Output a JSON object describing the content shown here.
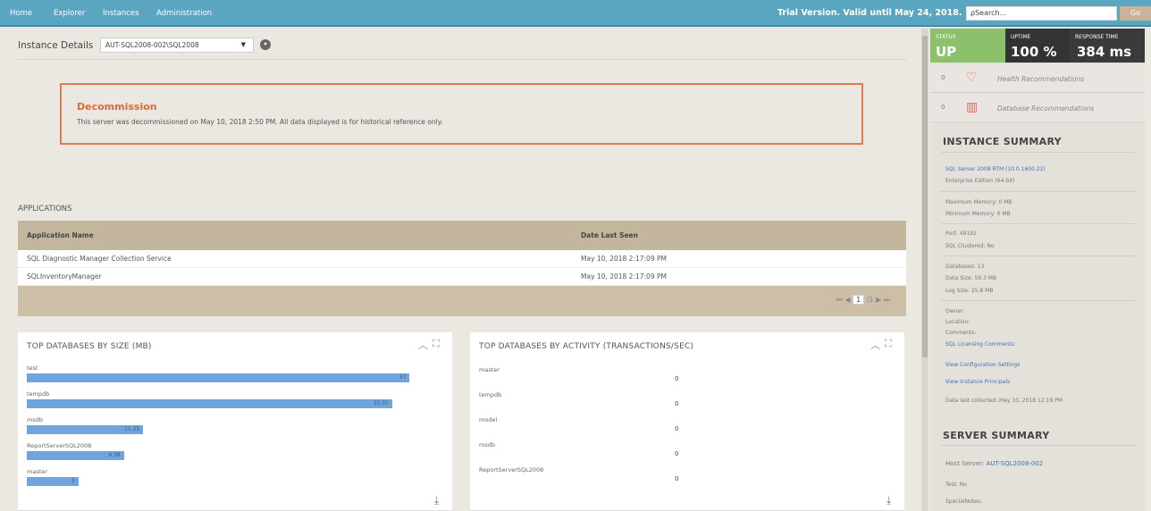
{
  "nav": {
    "items": [
      "Home",
      "Explorer",
      "Instances",
      "Administration"
    ],
    "trial": "Trial Version. Valid until May 24, 2018.",
    "search_placeholder": "Search...",
    "go": "Go"
  },
  "instance": {
    "label": "Instance Details",
    "selected": "AUT-SQL2008-002\\SQL2008"
  },
  "decommission": {
    "title": "Decommission",
    "text": "This server was decommissioned on May 10, 2018 2:50 PM. All data displayed is for historical reference only."
  },
  "applications": {
    "title": "APPLICATIONS",
    "columns": [
      "Application Name",
      "Date Last Seen"
    ],
    "rows": [
      {
        "name": "SQL Diagnostic Manager Collection Service",
        "date": "May 10, 2018 2:17:09 PM"
      },
      {
        "name": "SQLInventoryManager",
        "date": "May 10, 2018 2:17:09 PM"
      }
    ],
    "pager": {
      "current": "1",
      "total": "/1"
    }
  },
  "panels": {
    "size_title": "TOP DATABASES BY SIZE (MB)",
    "activity_title": "TOP DATABASES BY ACTIVITY (TRANSACTIONS/SEC)"
  },
  "chart_data": [
    {
      "type": "bar",
      "title": "TOP DATABASES BY SIZE (MB)",
      "categories": [
        "test",
        "tempdb",
        "msdb",
        "ReportServerSQL2008",
        "master"
      ],
      "values": [
        37,
        35.31,
        11.25,
        9.38,
        5
      ],
      "labels": [
        "37",
        "35.31",
        "11.25",
        "9.38",
        "5"
      ],
      "xlim": [
        0,
        38
      ]
    },
    {
      "type": "table",
      "title": "TOP DATABASES BY ACTIVITY (TRANSACTIONS/SEC)",
      "categories": [
        "master",
        "tempdb",
        "model",
        "msdb",
        "ReportServerSQL2008"
      ],
      "values": [
        0,
        0,
        0,
        0,
        0
      ]
    }
  ],
  "status": {
    "status_label": "STATUS",
    "status_value": "UP",
    "uptime_label": "UPTIME",
    "uptime_value": "100 %",
    "response_label": "RESPONSE TIME",
    "response_value": "384 ms",
    "health_count": "0",
    "health_label": "Health Recommendations",
    "db_count": "0",
    "db_label": "Database Recommendations"
  },
  "instance_summary": {
    "title": "INSTANCE SUMMARY",
    "version_link": "SQL Server 2008 RTM (10.0.1600.22)",
    "edition": "Enterprise Edition (64-bit)",
    "max_memory": "Maximum Memory: 0 MB",
    "min_memory": "Minimum Memory: 0 MB",
    "port": "Port: 49192",
    "clustered": "SQL Clustered: No",
    "databases": "Databases: 13",
    "data_size": "Data Size: 59.3 MB",
    "log_size": "Log Size: 25.8 MB",
    "owner": "Owner:",
    "location": "Location:",
    "comments": "Comments:",
    "licensing_link": "SQL Licensing Comments:",
    "config_link": "View Configuration Settings",
    "principals_link": "View Instance Principals",
    "last_collected": "Data last collected: May 10, 2018 12:19 PM"
  },
  "server_summary": {
    "title": "SERVER SUMMARY",
    "host_label": "Host Server:",
    "host_value": "AUT-SQL2008-002",
    "test": "Test: No",
    "special": "SpecialNotes:"
  },
  "colors": {
    "nav": "#5aa6c1",
    "status_up": "#8dc06b",
    "accent_orange": "#e06a35",
    "bar_blue": "#6fa5dc",
    "table_header": "#c4b69d"
  }
}
